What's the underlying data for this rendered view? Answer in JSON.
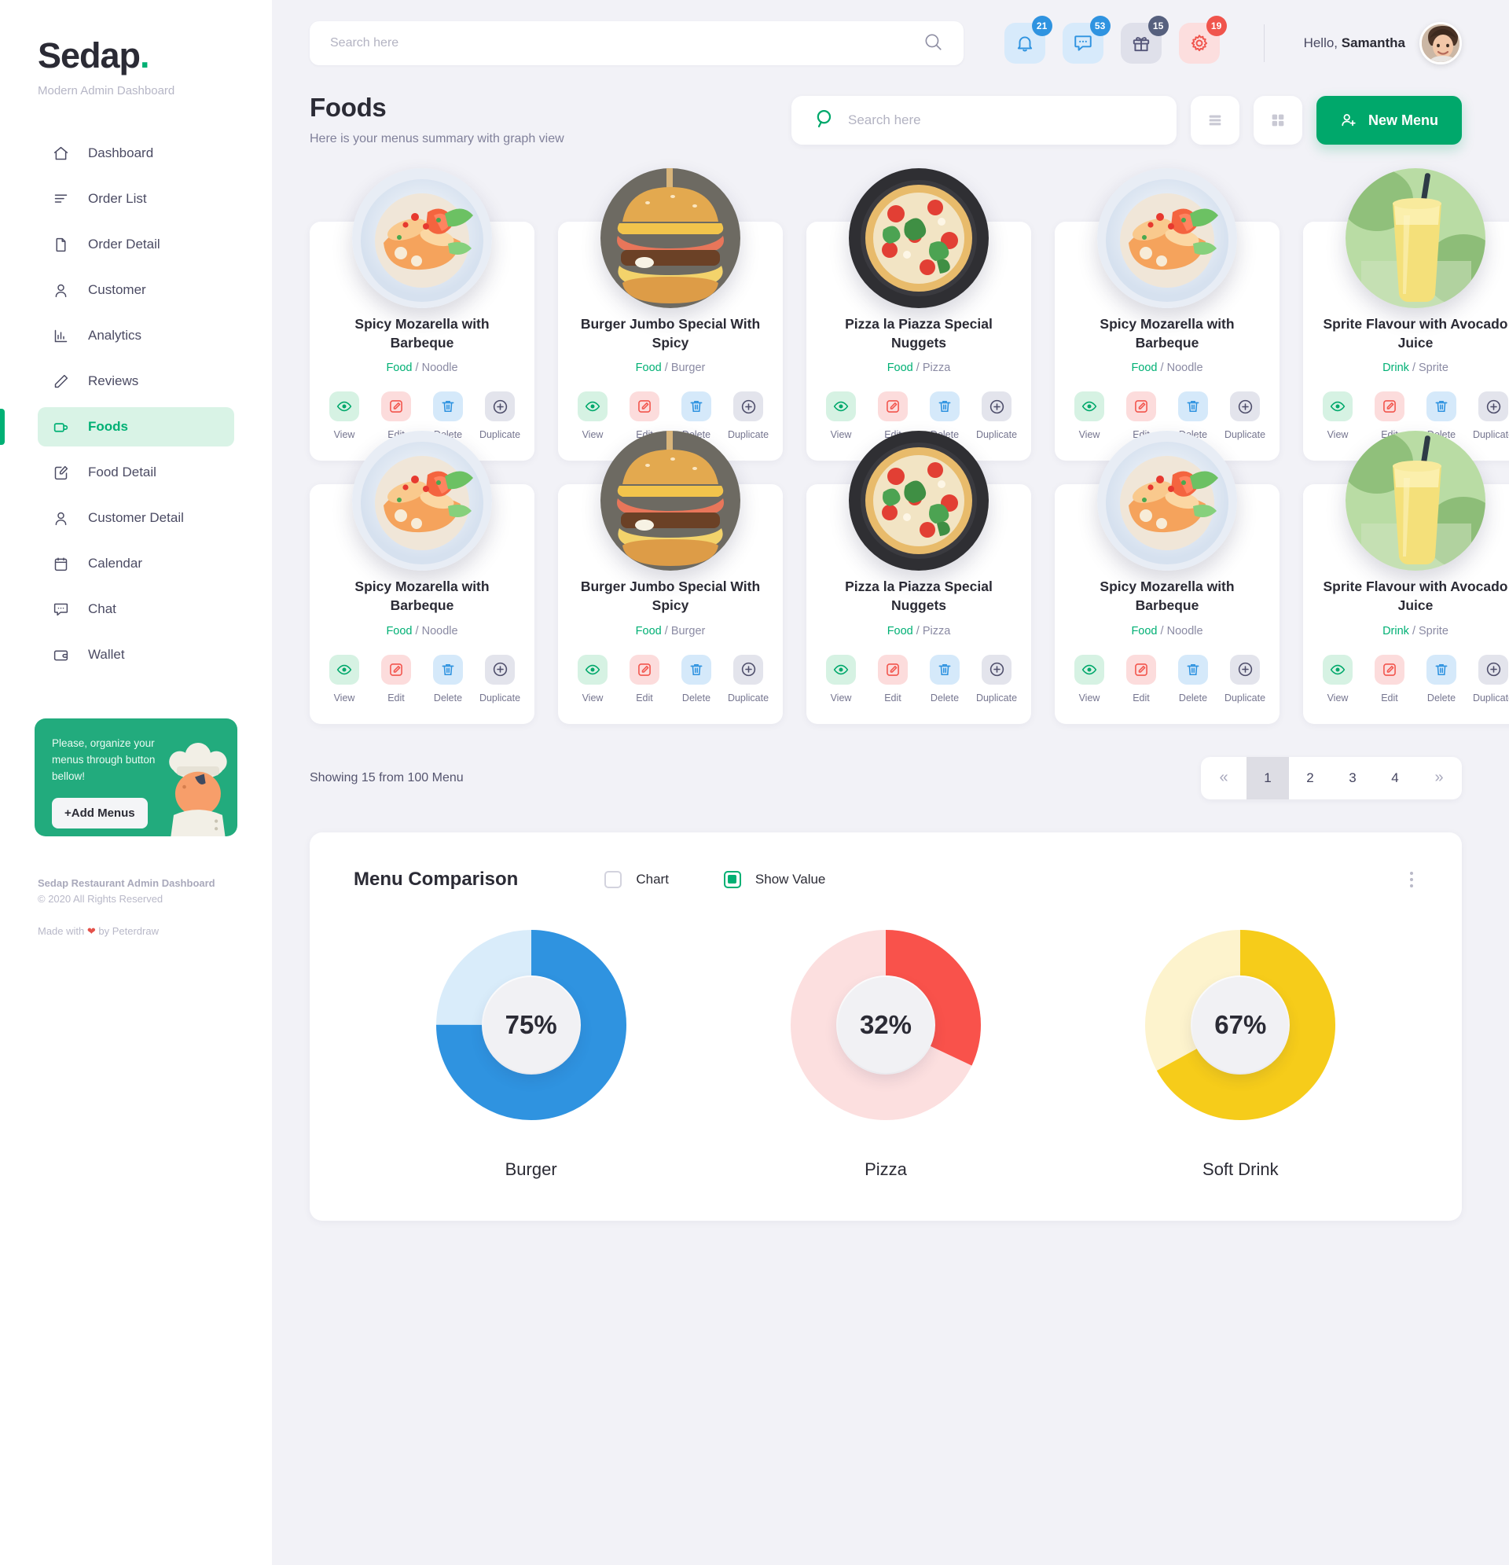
{
  "brand": {
    "name": "Sedap",
    "dot": ".",
    "subtitle": "Modern Admin Dashboard"
  },
  "sidebar": {
    "items": [
      {
        "label": "Dashboard",
        "icon": "home-icon"
      },
      {
        "label": "Order List",
        "icon": "list-icon"
      },
      {
        "label": "Order Detail",
        "icon": "document-icon"
      },
      {
        "label": "Customer",
        "icon": "user-icon"
      },
      {
        "label": "Analytics",
        "icon": "bar-chart-icon"
      },
      {
        "label": "Reviews",
        "icon": "pencil-icon"
      },
      {
        "label": "Foods",
        "icon": "cup-icon"
      },
      {
        "label": "Food Detail",
        "icon": "edit-square-icon"
      },
      {
        "label": "Customer Detail",
        "icon": "user-icon"
      },
      {
        "label": "Calendar",
        "icon": "calendar-icon"
      },
      {
        "label": "Chat",
        "icon": "chat-icon"
      },
      {
        "label": "Wallet",
        "icon": "wallet-icon"
      }
    ],
    "active_index": 6,
    "promo": {
      "text": "Please, organize your menus through button bellow!",
      "button": "+Add Menus"
    },
    "footer": {
      "line1": "Sedap Restaurant Admin Dashboard",
      "line2": "© 2020 All Rights Reserved",
      "made_prefix": "Made with ",
      "made_heart": "❤",
      "made_suffix": " by Peterdraw"
    }
  },
  "topbar": {
    "search_placeholder": "Search here",
    "search_value": "",
    "icons": [
      {
        "name": "bell-icon",
        "badge": "21",
        "tone": "blue"
      },
      {
        "name": "chat-icon",
        "badge": "53",
        "tone": "blue"
      },
      {
        "name": "gift-icon",
        "badge": "15",
        "tone": "grey"
      },
      {
        "name": "gear-icon",
        "badge": "19",
        "tone": "red"
      }
    ],
    "greeting_prefix": "Hello, ",
    "greeting_name": "Samantha"
  },
  "page": {
    "title": "Foods",
    "subtitle": "Here is your menus summary with graph view",
    "search_placeholder": "Search here",
    "search_value": "",
    "list_view_label": "list-view",
    "grid_view_label": "grid-view",
    "new_menu_label": "New Menu"
  },
  "cards": [
    {
      "name": "Spicy Mozarella with Barbeque",
      "cat_main": "Food",
      "cat_sep": " / ",
      "cat_sub": "Noodle",
      "image": "noodle"
    },
    {
      "name": "Burger Jumbo Special With Spicy",
      "cat_main": "Food",
      "cat_sep": " / ",
      "cat_sub": "Burger",
      "image": "burger"
    },
    {
      "name": "Pizza la Piazza Special Nuggets",
      "cat_main": "Food",
      "cat_sep": " / ",
      "cat_sub": "Pizza",
      "image": "pizza"
    },
    {
      "name": "Spicy Mozarella with Barbeque",
      "cat_main": "Food",
      "cat_sep": " / ",
      "cat_sub": "Noodle",
      "image": "noodle"
    },
    {
      "name": "Sprite Flavour with Avocado Juice",
      "cat_main": "Drink",
      "cat_sep": " / ",
      "cat_sub": "Sprite",
      "image": "drink"
    },
    {
      "name": "Spicy Mozarella with Barbeque",
      "cat_main": "Food",
      "cat_sep": " / ",
      "cat_sub": "Noodle",
      "image": "noodle"
    },
    {
      "name": "Burger Jumbo Special With Spicy",
      "cat_main": "Food",
      "cat_sep": " / ",
      "cat_sub": "Burger",
      "image": "burger"
    },
    {
      "name": "Pizza la Piazza Special Nuggets",
      "cat_main": "Food",
      "cat_sep": " / ",
      "cat_sub": "Pizza",
      "image": "pizza"
    },
    {
      "name": "Spicy Mozarella with Barbeque",
      "cat_main": "Food",
      "cat_sep": " / ",
      "cat_sub": "Noodle",
      "image": "noodle"
    },
    {
      "name": "Sprite Flavour with Avocado Juice",
      "cat_main": "Drink",
      "cat_sep": " / ",
      "cat_sub": "Sprite",
      "image": "drink"
    }
  ],
  "card_actions": [
    {
      "label": "View",
      "icon": "eye-icon",
      "tone": "view"
    },
    {
      "label": "Edit",
      "icon": "edit-icon",
      "tone": "edit"
    },
    {
      "label": "Delete",
      "icon": "trash-icon",
      "tone": "del"
    },
    {
      "label": "Duplicate",
      "icon": "plus-circle-icon",
      "tone": "dup"
    }
  ],
  "footer_bar": {
    "showing": "Showing 15 from 100 Menu",
    "pagination": {
      "prev": "«",
      "next": "»",
      "pages": [
        "1",
        "2",
        "3",
        "4"
      ],
      "active": "1"
    }
  },
  "panel": {
    "title": "Menu Comparison",
    "toggle_chart": {
      "label": "Chart",
      "checked": false
    },
    "toggle_show_value": {
      "label": "Show Value",
      "checked": true
    },
    "menu_icon": "kebab-menu-icon"
  },
  "chart_data": {
    "type": "pie",
    "title": "Menu Comparison",
    "legend": "none",
    "series": [
      {
        "name": "Burger",
        "value": 75,
        "label": "75%",
        "color": "#2f93e0",
        "track": "#d9ecfa"
      },
      {
        "name": "Pizza",
        "value": 32,
        "label": "32%",
        "color": "#f9524b",
        "track": "#fcdfdf"
      },
      {
        "name": "Soft Drink",
        "value": 67,
        "label": "67%",
        "color": "#f6cc1a",
        "track": "#fdf3cd"
      }
    ],
    "categories": [
      "Burger",
      "Pizza",
      "Soft Drink"
    ],
    "values": [
      75,
      32,
      67
    ],
    "ylim": [
      0,
      100
    ]
  },
  "colors": {
    "brand_green": "#00b074",
    "accent_blue": "#2f93e0",
    "accent_red": "#f0544c",
    "accent_yellow": "#f6cc1a",
    "bg": "#f2f2f7"
  }
}
